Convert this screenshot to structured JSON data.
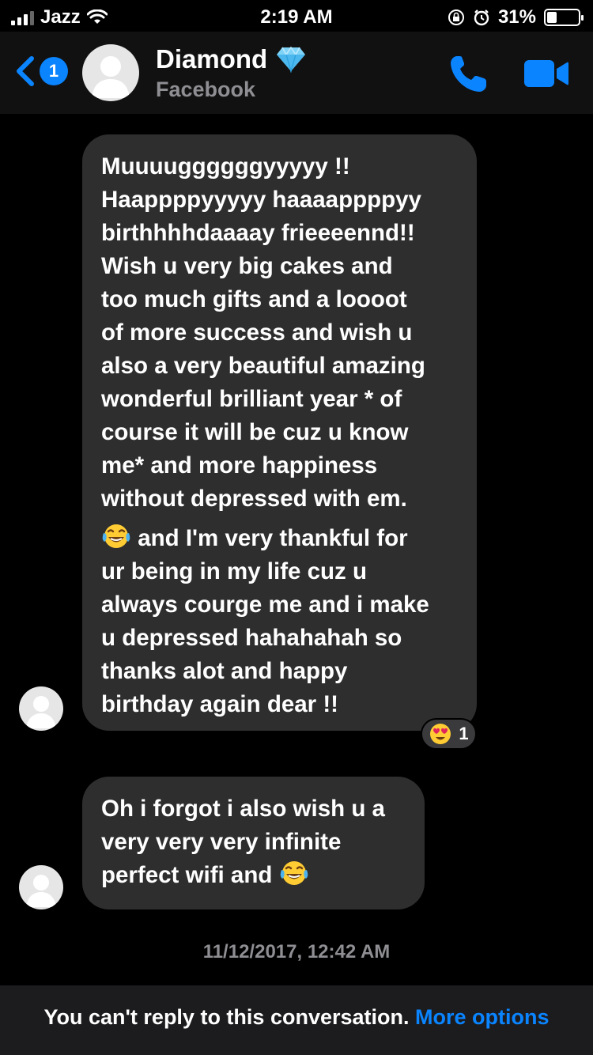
{
  "status_bar": {
    "carrier": "Jazz",
    "time": "2:19 AM",
    "battery": "31%",
    "battery_level": 0.31
  },
  "header": {
    "back_count": "1",
    "contact_name": "Diamond",
    "contact_subtitle": "Facebook"
  },
  "messages": [
    {
      "text": "Muuuuggggggyyyyy !!\nHaappppyyyyy haaaappppyy\nbirthhhhdaaaay frieeeennd!!\nWish u very big cakes and\ntoo much gifts and a loooot\nof more success and wish u\nalso a very beautiful amazing\nwonderful brilliant year * of\ncourse it will be cuz u know\nme* and more happiness\nwithout depressed with em.",
      "text_after_emoji": " and I'm very thankful for\nur being in my life cuz u\nalways courge me and i make\nu depressed hahahahah so\nthanks alot and happy\nbirthday again dear !!",
      "reaction_count": "1"
    },
    {
      "text": "Oh i forgot i also wish u a\nvery very very infinite\nperfect wifi and "
    }
  ],
  "timestamp": "11/12/2017, 12:42 AM",
  "footer": {
    "notice": "You can't reply to this conversation.",
    "more_options": "More options"
  },
  "colors": {
    "accent": "#0a84ff",
    "bubble": "#2e2e2e",
    "background": "#000000"
  }
}
